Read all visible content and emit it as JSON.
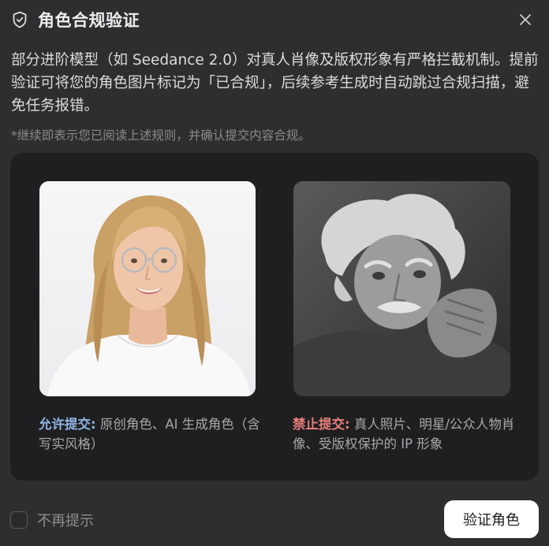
{
  "dialog": {
    "title": "角色合规验证",
    "close_icon": "close-icon",
    "shield_icon": "shield-icon"
  },
  "description": "部分进阶模型（如 Seedance 2.0）对真人肖像及版权形象有严格拦截机制。提前验证可将您的角色图片标记为「已合规」，后续参考生成时自动跳过合规扫描，避免任务报错。",
  "note": "*继续即表示您已阅读上述规则，并确认提交内容合规。",
  "examples": {
    "allowed": {
      "tag": "允许提交:",
      "text": " 原创角色、AI 生成角色（含写实风格）",
      "tag_color": "#8fb4e3"
    },
    "forbidden": {
      "tag": "禁止提交:",
      "text": " 真人照片、明星/公众人物肖像、受版权保护的 IP 形象",
      "tag_color": "#e87f7b"
    }
  },
  "footer": {
    "dont_show_again": "不再提示",
    "verify_button": "验证角色"
  }
}
